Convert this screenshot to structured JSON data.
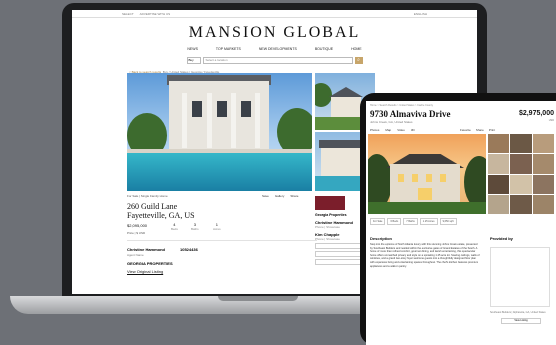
{
  "laptop": {
    "topbar": {
      "left": "SELECT",
      "left2": "ADVERTISE WITH US",
      "lang": "ENGLISH"
    },
    "brand": "MANSION GLOBAL",
    "nav": [
      "NEWS",
      "TOP MARKETS",
      "NEW DEVELOPMENTS",
      "BOUTIQUE",
      "HOME"
    ],
    "search": {
      "select": "Buy",
      "placeholder": "Select a location",
      "button_icon": "search-icon"
    },
    "breadcrumb": {
      "back": "< Back to search results",
      "path": "Buy / United States / Georgia / Fayetteville"
    },
    "listing": {
      "tagline": "For Sale | Single Family Home",
      "actions": [
        "Save",
        "Gallery",
        "Share"
      ],
      "address_line1": "260 Guild Lane",
      "address_line2": "Fayetteville, GA, US",
      "price": "$2,095,000",
      "stats": [
        {
          "value": "4",
          "label": "Beds"
        },
        {
          "value": "3",
          "label": "Baths"
        },
        {
          "value": "1",
          "label": "Acres"
        }
      ],
      "unit_select": "Price | $ USD"
    },
    "agent": {
      "name": "Christine Hammond",
      "role": "Agent Name",
      "phone": "10524436",
      "firm": "GEORGIA PROPERTIES",
      "link": "View Original Listing"
    },
    "sidebar": {
      "firm": "Georgia Properties",
      "agent1": "Christine Hammond",
      "agent1_sub": "Phone | Showcase",
      "agent2": "Kim Chapple",
      "agent2_sub": "Phone | Showcase"
    }
  },
  "tablet": {
    "breadcrumb": "Home > Search Results > United States > Cache County",
    "title": "9730 Almaviva Drive",
    "subtitle": "Johns Creek, GA, United States",
    "price": "$2,975,000",
    "price_sub": "USD",
    "tools_left": [
      "Photos",
      "Map",
      "Video",
      "3D"
    ],
    "tools_right": [
      "Favorite",
      "Share",
      "Print"
    ],
    "tags": [
      "For Sale",
      "6 Beds",
      "7 Baths",
      "1.25 Acres",
      "9,650 sqft"
    ],
    "section": "Description",
    "description": "Step into the epitome of North Atlanta luxury with this stunning Johns Creek estate, presented by Southeast Builders and nestled within the exclusive gates of Grand Estates of the South. A home of more than refined comfort, gourmet dining, and lavish entertaining, this spectacular home offers unmatched privacy and style on a sprawling 1.25 acre lot. Soaring ceilings, walls of windows, and a grand two-story foyer welcome guests into a thoughtfully designed floor plan with expansive living and entertaining spaces throughout. The chef's kitchen features premium appliances and a walk-in pantry.",
    "provided_by": "Provided by",
    "provider_address": "Southeast Builders | Alpharetta, GA, United States",
    "button": "View Listing"
  }
}
